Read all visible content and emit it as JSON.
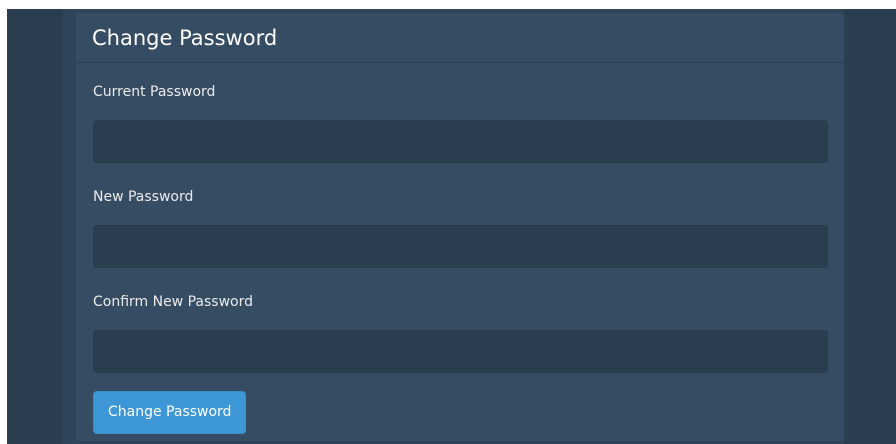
{
  "panel": {
    "title": "Change Password"
  },
  "form": {
    "fields": [
      {
        "label": "Current Password",
        "value": "",
        "placeholder": ""
      },
      {
        "label": "New Password",
        "value": "",
        "placeholder": ""
      },
      {
        "label": "Confirm New Password",
        "value": "",
        "placeholder": ""
      }
    ],
    "submit_label": "Change Password"
  },
  "colors": {
    "background": "#2b3e50",
    "panel": "#364c63",
    "input": "#2b3e50",
    "primary_button": "#3d97d6",
    "text": "#ebebeb"
  }
}
